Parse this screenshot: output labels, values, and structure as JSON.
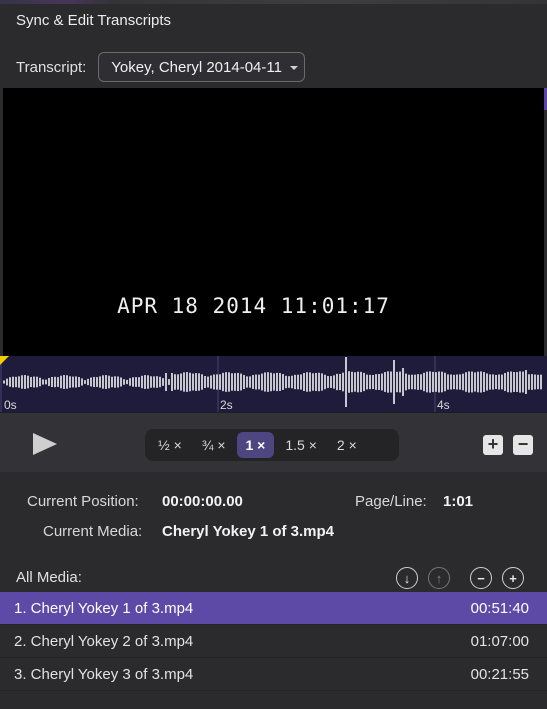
{
  "window": {
    "title": "Sync & Edit Transcripts"
  },
  "transcript": {
    "label": "Transcript:",
    "selected": "Yokey, Cheryl 2014-04-11"
  },
  "video": {
    "timestamp": "APR 18 2014 11:01:17"
  },
  "waveform": {
    "ticks": [
      "0s",
      "2s",
      "4s"
    ]
  },
  "playback": {
    "speeds": [
      {
        "label": "½ ×",
        "active": false
      },
      {
        "label": "¾ ×",
        "active": false
      },
      {
        "label": "1 ×",
        "active": true
      },
      {
        "label": "1.5 ×",
        "active": false
      },
      {
        "label": "2 ×",
        "active": false
      }
    ]
  },
  "info": {
    "position_label": "Current Position:",
    "position_value": "00:00:00.00",
    "pageline_label": "Page/Line:",
    "pageline_value": "1:01",
    "media_label": "Current Media:",
    "media_value": "Cheryl Yokey 1 of 3.mp4"
  },
  "media": {
    "header": "All Media:",
    "items": [
      {
        "name": "1.  Cheryl Yokey 1 of 3.mp4",
        "duration": "00:51:40",
        "selected": true
      },
      {
        "name": "2.  Cheryl Yokey 2 of 3.mp4",
        "duration": "01:07:00",
        "selected": false
      },
      {
        "name": "3.  Cheryl Yokey 3 of 3.mp4",
        "duration": "00:21:55",
        "selected": false
      }
    ]
  },
  "colors": {
    "accent": "#5d4aa6",
    "waveform_bg": "#1f1b3a",
    "playhead": "#f5d000"
  }
}
